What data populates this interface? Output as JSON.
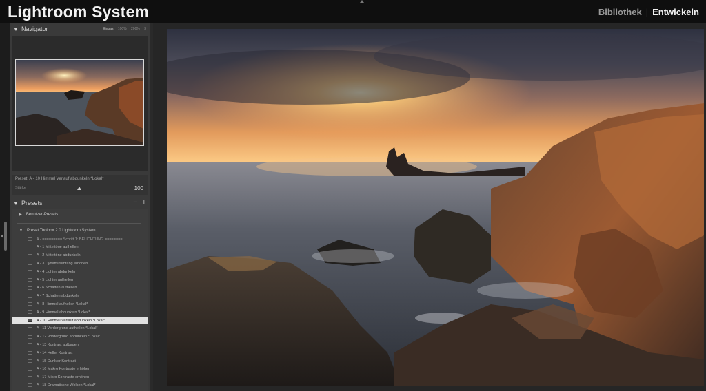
{
  "app": {
    "title": "Lightroom System"
  },
  "modules": {
    "library": "Bibliothek",
    "separator": "|",
    "develop": "Entwickeln"
  },
  "navigator": {
    "title": "Navigator",
    "zoom_options": [
      "Einpas",
      "100%",
      "200%"
    ],
    "zoom_extra": "3"
  },
  "preset_info": {
    "name": "Preset: A - 10 Himmel Verlauf abdunkeln *Lokal*",
    "strength_label": "Stärke",
    "strength_value": "100",
    "strength_level": 1.0
  },
  "presets_panel": {
    "title": "Presets",
    "minus": "−",
    "plus": "+",
    "groups": [
      {
        "label": "Benutzer-Presets"
      },
      {
        "label": "Preset Toolbox 2.0 Lightroom System"
      }
    ],
    "items": [
      {
        "label": "A - ========= Schritt 1: BELICHTUNG ========",
        "selected": false,
        "header": true
      },
      {
        "label": "A - 1 Mitteltöne aufhellen",
        "selected": false
      },
      {
        "label": "A - 2 Mitteltöne abdunkeln",
        "selected": false
      },
      {
        "label": "A - 3 Dynamikumfang erhöhen",
        "selected": false
      },
      {
        "label": "A - 4 Lichter abdunkeln",
        "selected": false
      },
      {
        "label": "A - 5 Lichter aufhellen",
        "selected": false
      },
      {
        "label": "A - 6 Schatten aufhellen",
        "selected": false
      },
      {
        "label": "A - 7 Schatten abdunkeln",
        "selected": false
      },
      {
        "label": "A - 8 Himmel aufhellen *Lokal*",
        "selected": false
      },
      {
        "label": "A - 9 Himmel abdunkeln *Lokal*",
        "selected": false
      },
      {
        "label": "A - 10 Himmel Verlauf abdunkeln *Lokal*",
        "selected": true
      },
      {
        "label": "A - 11 Vordergrund aufhellen *Lokal*",
        "selected": false
      },
      {
        "label": "A - 12 Vordergrund abdunkeln *Lokal*",
        "selected": false
      },
      {
        "label": "A - 13 Kontrast aufbauen",
        "selected": false
      },
      {
        "label": "A - 14 Heller Kontrast",
        "selected": false
      },
      {
        "label": "A - 15 Dunkler Kontrast",
        "selected": false
      },
      {
        "label": "A - 16 Makro Kontraste erhöhen",
        "selected": false
      },
      {
        "label": "A - 17 Mikro Kontraste erhöhen",
        "selected": false
      },
      {
        "label": "A - 18 Dramatische Wolken *Lokal*",
        "selected": false
      }
    ]
  },
  "colors": {
    "accent": "#e2e2e2",
    "panel": "#3a3a3a",
    "background": "#262626"
  }
}
